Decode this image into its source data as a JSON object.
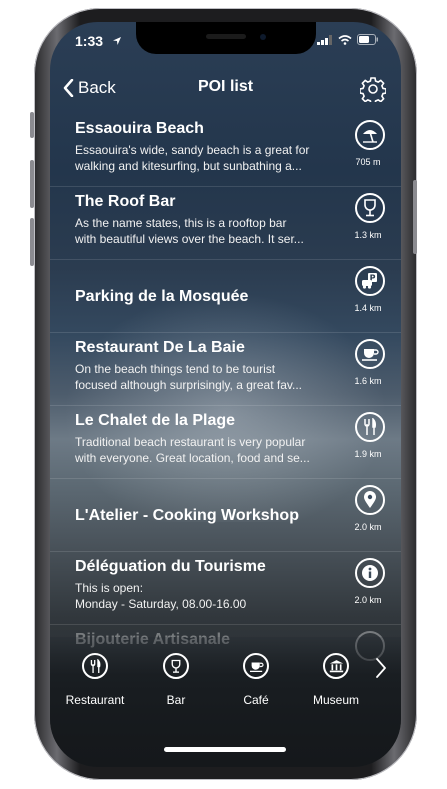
{
  "status": {
    "time": "1:33"
  },
  "nav": {
    "back_label": "Back",
    "title": "POI list"
  },
  "pois": [
    {
      "name": "Essaouira Beach",
      "desc1": "Essaouira's wide, sandy beach is a great for",
      "desc2": "walking and kitesurfing, but sunbathing a...",
      "distance": "705 m",
      "icon": "beach-umbrella-icon"
    },
    {
      "name": "The Roof Bar",
      "desc1": "As the name states, this is a rooftop bar",
      "desc2": "with beautiful views over the beach. It ser...",
      "distance": "1.3 km",
      "icon": "wine-glass-icon"
    },
    {
      "name": "Parking de la Mosquée",
      "desc1": "",
      "desc2": "",
      "distance": "1.4 km",
      "icon": "parking-icon"
    },
    {
      "name": "Restaurant De La Baie",
      "desc1": "On the beach things tend to be tourist",
      "desc2": "focused although surprisingly, a great fav...",
      "distance": "1.6 km",
      "icon": "coffee-cup-icon"
    },
    {
      "name": "Le Chalet de la Plage",
      "desc1": "Traditional beach restaurant is very popular",
      "desc2": "with everyone. Great location, food and se...",
      "distance": "1.9 km",
      "icon": "fork-knife-icon"
    },
    {
      "name": "L'Atelier - Cooking Workshop",
      "desc1": "",
      "desc2": "",
      "distance": "2.0 km",
      "icon": "location-pin-icon"
    },
    {
      "name": "Déléguation du Tourisme",
      "desc1": "This is open:",
      "desc2": "Monday - Saturday, 08.00-16.00",
      "distance": "2.0 km",
      "icon": "info-icon"
    },
    {
      "name": "Bijouterie Artisanale",
      "desc1": "",
      "desc2": "",
      "distance": "",
      "icon": "shop-icon"
    }
  ],
  "categories": [
    {
      "label": "Restaurant",
      "icon": "fork-knife-icon"
    },
    {
      "label": "Bar",
      "icon": "wine-glass-icon"
    },
    {
      "label": "Café",
      "icon": "coffee-cup-icon"
    },
    {
      "label": "Museum",
      "icon": "museum-icon"
    }
  ]
}
